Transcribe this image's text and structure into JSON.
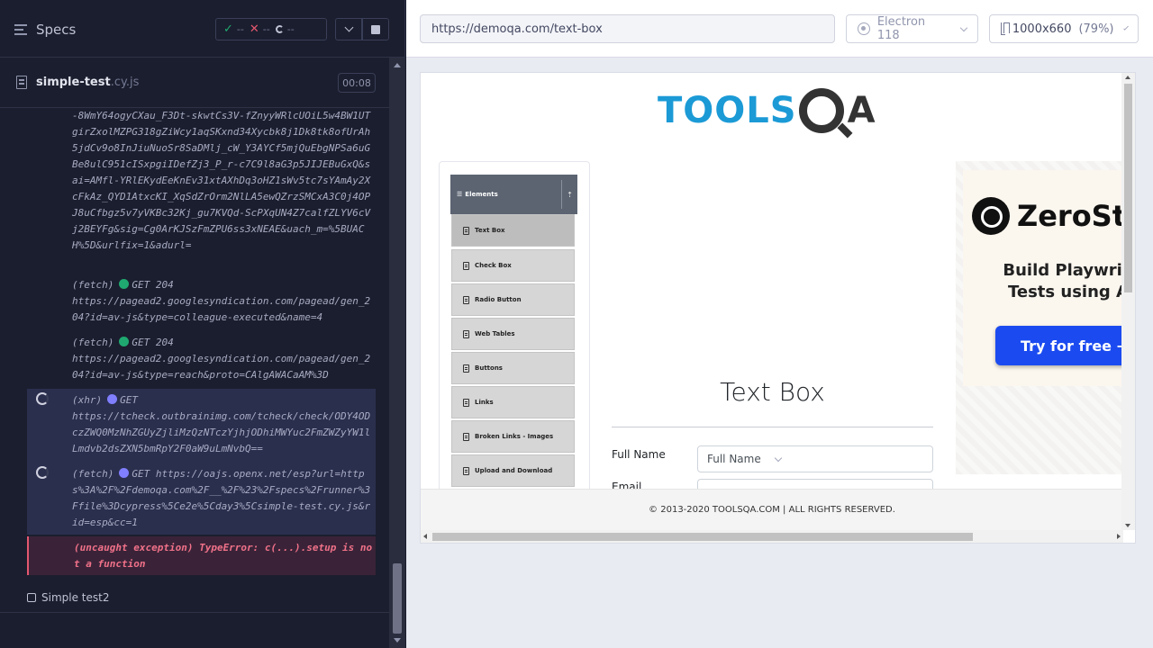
{
  "reporter": {
    "specs_label": "Specs",
    "stats": {
      "passed": "--",
      "failed": "--",
      "pending": "--"
    },
    "spec_file": {
      "name": "simple-test",
      "ext": ".cy.js",
      "duration": "00:08"
    },
    "log": [
      {
        "kind": "text",
        "text": "-8WmY64ogyCXau_F3Dt-skwtCs3V-fZnyyWRlcUOiL5w4BW1UTgirZxolMZPG318gZiWcy1aqSKxnd34Xycbk8j1Dk8tk8ofUrAh5jdCv9o8InJiuNuoSr8SaDMlj_cW_Y3AYCf5mjQuEbgNPSa6uGBe8ulC951cISxpgiIDefZj3_P_r-c7C9l8aG3p5JIJEBuGxQ&sai=AMfl-YRlEKydEeKnEv31xtAXhDq3oHZ1sWv5tc7sYAmAy2XcFkAz_QYD1AtxcKI_XqSdZrOrm2NlLA5ewQZrzSMCxA3C0j4OPJ8uCfbgz5v7yVKBc32Kj_gu7KVQd-ScPXqUN4Z7calfZLYV6cVj2BEYFg&sig=Cg0ArKJSzFmZPU6ss3xNEAE&uach_m=%5BUACH%5D&urlfix=1&adurl="
      },
      {
        "kind": "fetch",
        "label": "(fetch)",
        "status": "GET 204",
        "url": "https://pagead2.googlesyndication.com/pagead/gen_204?id=av-js&type=colleague-executed&name=4"
      },
      {
        "kind": "fetch",
        "label": "(fetch)",
        "status": "GET 204",
        "url": "https://pagead2.googlesyndication.com/pagead/gen_204?id=av-js&type=reach&proto=CAlgAWACaAM%3D"
      },
      {
        "kind": "xhr",
        "label": "(xhr)",
        "status": "GET",
        "url": "https://tcheck.outbrainimg.com/tcheck/check/ODY4ODczZWQ0MzNhZGUyZjliMzQzNTczYjhjODhiMWYuc2FmZWZyYW1lLmdvb2dsZXN5bmRpY2F0aW9uLmNvbQ=="
      },
      {
        "kind": "fetch",
        "label": "(fetch)",
        "status": "GET",
        "url": "https://oajs.openx.net/esp?url=https%3A%2F%2Fdemoqa.com%2F__%2F%23%2Fspecs%2Frunner%3Ffile%3Dcypress%5Ce2e%5Cday3%5Csimple-test.cy.js&rid=esp&cc=1"
      },
      {
        "kind": "error",
        "text": "(uncaught exception)  TypeError: c(...).setup is not a function"
      }
    ],
    "next_test": "Simple test2"
  },
  "aut": {
    "url": "https://demoqa.com/text-box",
    "browser": "Electron 118",
    "viewport": "1000x660",
    "viewport_scale": "(79%)"
  },
  "page": {
    "logo": {
      "text": "TOOLS",
      "suffix": "A"
    },
    "nav_header": "Elements",
    "nav_items": [
      "Text Box",
      "Check Box",
      "Radio Button",
      "Web Tables",
      "Buttons",
      "Links",
      "Broken Links - Images",
      "Upload and Download"
    ],
    "heading": "Text Box",
    "full_name_label": "Full Name",
    "full_name_placeholder": "Full Name",
    "email_label": "Email",
    "ad": {
      "brand": "ZeroSt",
      "tagline_1": "Build Playwrig",
      "tagline_2": "Tests using A",
      "cta": "Try for free →"
    },
    "footer": "© 2013-2020 TOOLSQA.COM | ALL RIGHTS RESERVED."
  }
}
